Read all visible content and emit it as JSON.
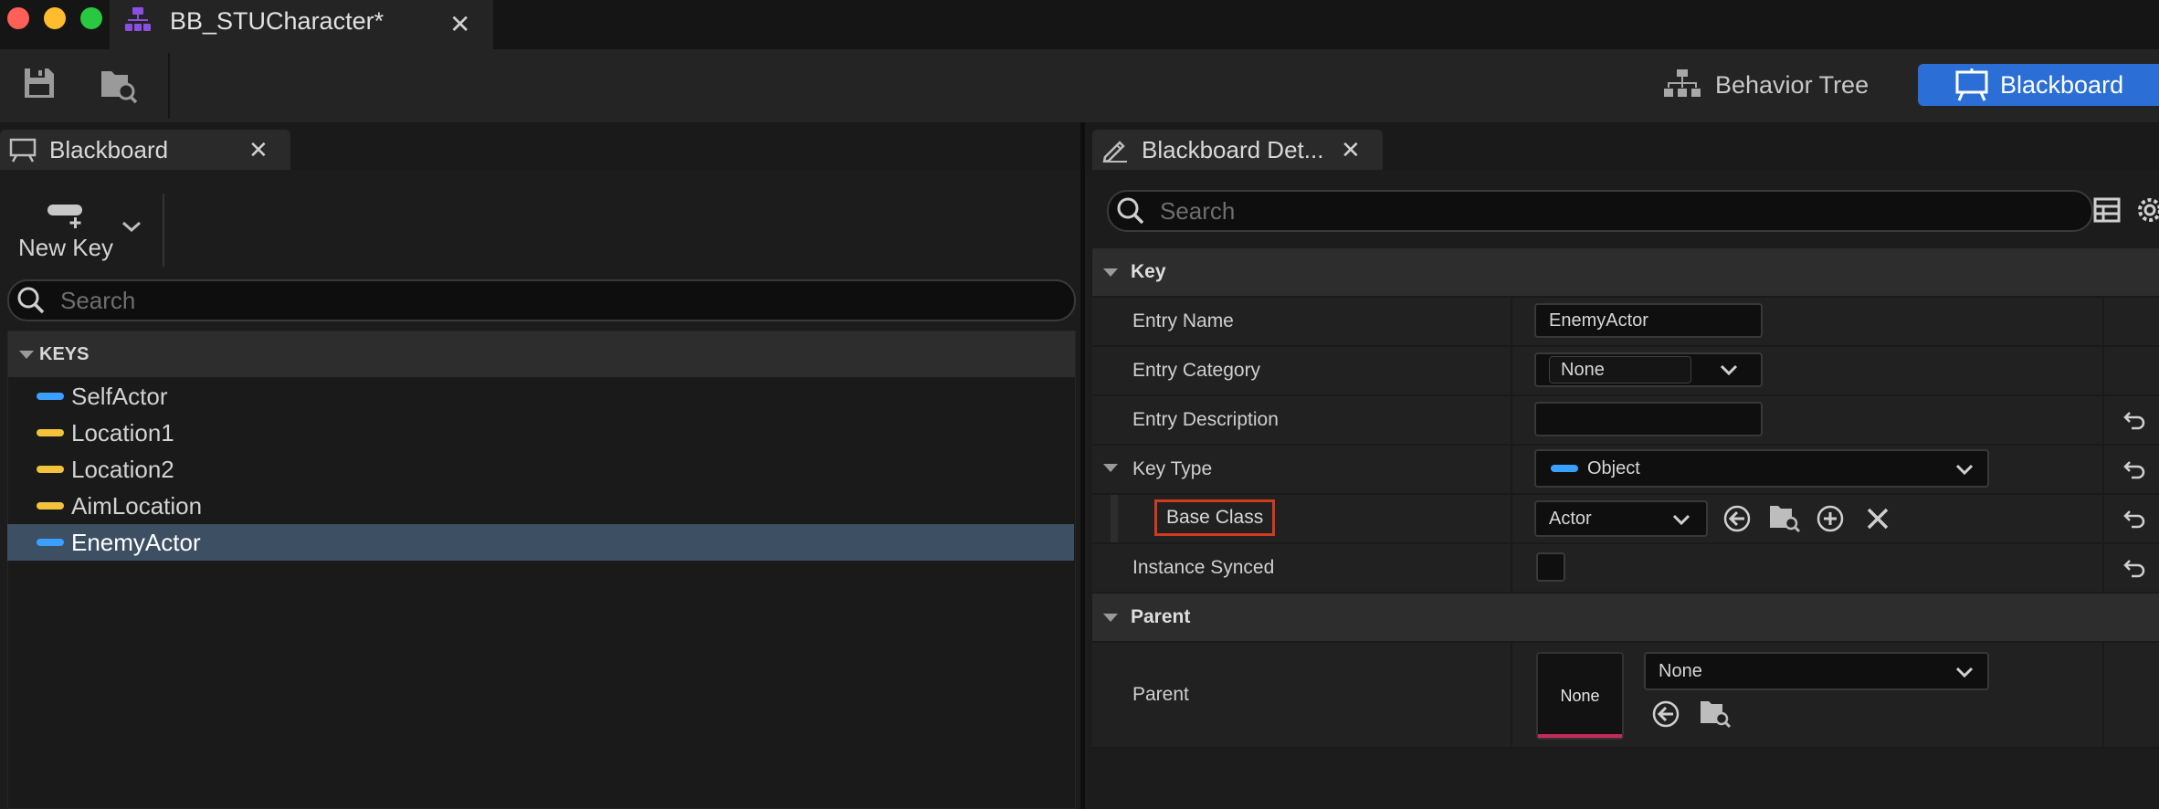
{
  "window": {
    "tab_title": "BB_STUCharacter*"
  },
  "toolbar": {
    "modes": [
      "Behavior Tree",
      "Blackboard"
    ],
    "active_mode": "Blackboard"
  },
  "left_panel": {
    "tab_title": "Blackboard",
    "new_key_label": "New Key",
    "search_placeholder": "Search",
    "section_title": "KEYS",
    "keys": [
      {
        "name": "SelfActor",
        "color": "#3aa0ff"
      },
      {
        "name": "Location1",
        "color": "#f2c23a"
      },
      {
        "name": "Location2",
        "color": "#f2c23a"
      },
      {
        "name": "AimLocation",
        "color": "#f2c23a"
      },
      {
        "name": "EnemyActor",
        "color": "#3aa0ff",
        "selected": true
      }
    ]
  },
  "details": {
    "tab_title": "Blackboard Det...",
    "search_placeholder": "Search",
    "key_section": "Key",
    "entry_name_label": "Entry Name",
    "entry_name_value": "EnemyActor",
    "entry_category_label": "Entry Category",
    "entry_category_value": "None",
    "entry_description_label": "Entry Description",
    "entry_description_value": "",
    "key_type_label": "Key Type",
    "key_type_value": "Object",
    "base_class_label": "Base Class",
    "base_class_value": "Actor",
    "instance_synced_label": "Instance Synced",
    "parent_section": "Parent",
    "parent_label": "Parent",
    "parent_thumb_text": "None",
    "parent_value": "None"
  },
  "colors": {
    "accent": "#2b6fd6",
    "object_pill": "#3aa0ff",
    "vector_pill": "#f2c23a",
    "highlight_outline": "#d03a1f",
    "selected_row": "#3d4f63",
    "tab_icon": "#8a4ee0"
  }
}
